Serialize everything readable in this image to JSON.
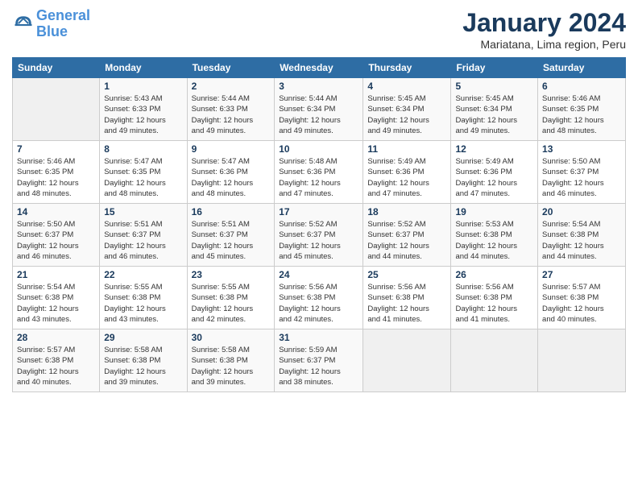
{
  "logo": {
    "line1": "General",
    "line2": "Blue"
  },
  "title": "January 2024",
  "location": "Mariatana, Lima region, Peru",
  "columns": [
    "Sunday",
    "Monday",
    "Tuesday",
    "Wednesday",
    "Thursday",
    "Friday",
    "Saturday"
  ],
  "weeks": [
    [
      {
        "day": "",
        "info": ""
      },
      {
        "day": "1",
        "info": "Sunrise: 5:43 AM\nSunset: 6:33 PM\nDaylight: 12 hours\nand 49 minutes."
      },
      {
        "day": "2",
        "info": "Sunrise: 5:44 AM\nSunset: 6:33 PM\nDaylight: 12 hours\nand 49 minutes."
      },
      {
        "day": "3",
        "info": "Sunrise: 5:44 AM\nSunset: 6:34 PM\nDaylight: 12 hours\nand 49 minutes."
      },
      {
        "day": "4",
        "info": "Sunrise: 5:45 AM\nSunset: 6:34 PM\nDaylight: 12 hours\nand 49 minutes."
      },
      {
        "day": "5",
        "info": "Sunrise: 5:45 AM\nSunset: 6:34 PM\nDaylight: 12 hours\nand 49 minutes."
      },
      {
        "day": "6",
        "info": "Sunrise: 5:46 AM\nSunset: 6:35 PM\nDaylight: 12 hours\nand 48 minutes."
      }
    ],
    [
      {
        "day": "7",
        "info": "Sunrise: 5:46 AM\nSunset: 6:35 PM\nDaylight: 12 hours\nand 48 minutes."
      },
      {
        "day": "8",
        "info": "Sunrise: 5:47 AM\nSunset: 6:35 PM\nDaylight: 12 hours\nand 48 minutes."
      },
      {
        "day": "9",
        "info": "Sunrise: 5:47 AM\nSunset: 6:36 PM\nDaylight: 12 hours\nand 48 minutes."
      },
      {
        "day": "10",
        "info": "Sunrise: 5:48 AM\nSunset: 6:36 PM\nDaylight: 12 hours\nand 47 minutes."
      },
      {
        "day": "11",
        "info": "Sunrise: 5:49 AM\nSunset: 6:36 PM\nDaylight: 12 hours\nand 47 minutes."
      },
      {
        "day": "12",
        "info": "Sunrise: 5:49 AM\nSunset: 6:36 PM\nDaylight: 12 hours\nand 47 minutes."
      },
      {
        "day": "13",
        "info": "Sunrise: 5:50 AM\nSunset: 6:37 PM\nDaylight: 12 hours\nand 46 minutes."
      }
    ],
    [
      {
        "day": "14",
        "info": "Sunrise: 5:50 AM\nSunset: 6:37 PM\nDaylight: 12 hours\nand 46 minutes."
      },
      {
        "day": "15",
        "info": "Sunrise: 5:51 AM\nSunset: 6:37 PM\nDaylight: 12 hours\nand 46 minutes."
      },
      {
        "day": "16",
        "info": "Sunrise: 5:51 AM\nSunset: 6:37 PM\nDaylight: 12 hours\nand 45 minutes."
      },
      {
        "day": "17",
        "info": "Sunrise: 5:52 AM\nSunset: 6:37 PM\nDaylight: 12 hours\nand 45 minutes."
      },
      {
        "day": "18",
        "info": "Sunrise: 5:52 AM\nSunset: 6:37 PM\nDaylight: 12 hours\nand 44 minutes."
      },
      {
        "day": "19",
        "info": "Sunrise: 5:53 AM\nSunset: 6:38 PM\nDaylight: 12 hours\nand 44 minutes."
      },
      {
        "day": "20",
        "info": "Sunrise: 5:54 AM\nSunset: 6:38 PM\nDaylight: 12 hours\nand 44 minutes."
      }
    ],
    [
      {
        "day": "21",
        "info": "Sunrise: 5:54 AM\nSunset: 6:38 PM\nDaylight: 12 hours\nand 43 minutes."
      },
      {
        "day": "22",
        "info": "Sunrise: 5:55 AM\nSunset: 6:38 PM\nDaylight: 12 hours\nand 43 minutes."
      },
      {
        "day": "23",
        "info": "Sunrise: 5:55 AM\nSunset: 6:38 PM\nDaylight: 12 hours\nand 42 minutes."
      },
      {
        "day": "24",
        "info": "Sunrise: 5:56 AM\nSunset: 6:38 PM\nDaylight: 12 hours\nand 42 minutes."
      },
      {
        "day": "25",
        "info": "Sunrise: 5:56 AM\nSunset: 6:38 PM\nDaylight: 12 hours\nand 41 minutes."
      },
      {
        "day": "26",
        "info": "Sunrise: 5:56 AM\nSunset: 6:38 PM\nDaylight: 12 hours\nand 41 minutes."
      },
      {
        "day": "27",
        "info": "Sunrise: 5:57 AM\nSunset: 6:38 PM\nDaylight: 12 hours\nand 40 minutes."
      }
    ],
    [
      {
        "day": "28",
        "info": "Sunrise: 5:57 AM\nSunset: 6:38 PM\nDaylight: 12 hours\nand 40 minutes."
      },
      {
        "day": "29",
        "info": "Sunrise: 5:58 AM\nSunset: 6:38 PM\nDaylight: 12 hours\nand 39 minutes."
      },
      {
        "day": "30",
        "info": "Sunrise: 5:58 AM\nSunset: 6:38 PM\nDaylight: 12 hours\nand 39 minutes."
      },
      {
        "day": "31",
        "info": "Sunrise: 5:59 AM\nSunset: 6:37 PM\nDaylight: 12 hours\nand 38 minutes."
      },
      {
        "day": "",
        "info": ""
      },
      {
        "day": "",
        "info": ""
      },
      {
        "day": "",
        "info": ""
      }
    ]
  ]
}
